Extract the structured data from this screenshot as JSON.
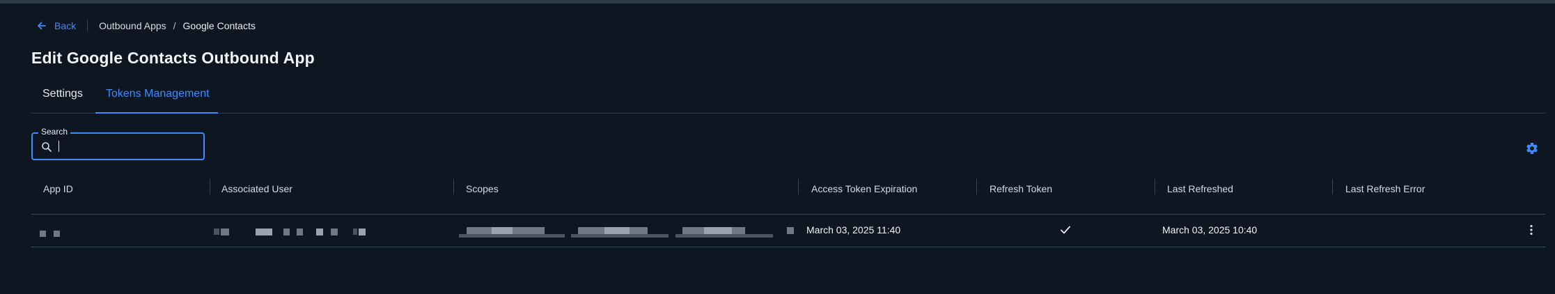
{
  "breadcrumb": {
    "back_label": "Back",
    "items": [
      "Outbound Apps",
      "Google Contacts"
    ],
    "separator": "/"
  },
  "page_title": "Edit Google Contacts Outbound App",
  "tabs": [
    {
      "label": "Settings",
      "active": false
    },
    {
      "label": "Tokens Management",
      "active": true
    }
  ],
  "search": {
    "label": "Search",
    "value": "",
    "icon": "search-icon"
  },
  "table": {
    "columns": [
      "App ID",
      "Associated User",
      "Scopes",
      "Access Token Expiration",
      "Refresh Token",
      "Last Refreshed",
      "Last Refresh Error"
    ],
    "rows": [
      {
        "access_token_expiration": "March 03, 2025 11:40",
        "refresh_token": true,
        "last_refreshed": "March 03, 2025 10:40"
      }
    ]
  },
  "colors": {
    "background": "#0e1621",
    "accent": "#3d8bff",
    "text": "#e6ebf1"
  }
}
